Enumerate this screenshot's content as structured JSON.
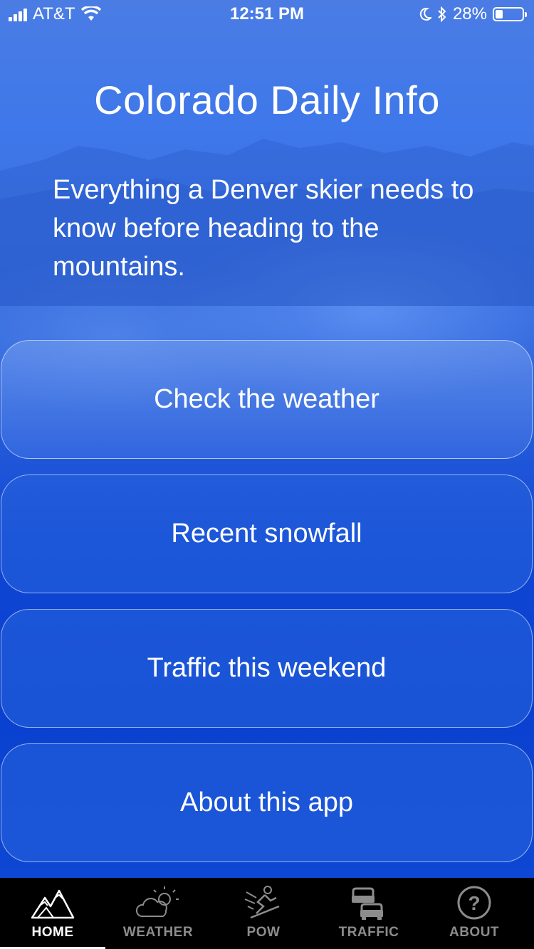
{
  "status_bar": {
    "carrier": "AT&T",
    "time": "12:51 PM",
    "battery_percent": "28%",
    "battery_level": 0.28
  },
  "header": {
    "title": "Colorado Daily Info",
    "subtitle": "Everything a Denver skier needs to know before heading to the mountains."
  },
  "menu": [
    {
      "label": "Check the weather"
    },
    {
      "label": "Recent snowfall"
    },
    {
      "label": "Traffic this weekend"
    },
    {
      "label": "About this app"
    }
  ],
  "tabbar": {
    "active": "HOME",
    "tabs": [
      {
        "label": "HOME",
        "icon": "mountains-icon"
      },
      {
        "label": "WEATHER",
        "icon": "partly-cloudy-icon"
      },
      {
        "label": "POW",
        "icon": "skier-icon"
      },
      {
        "label": "TRAFFIC",
        "icon": "cars-icon"
      },
      {
        "label": "ABOUT",
        "icon": "question-icon"
      }
    ]
  },
  "colors": {
    "background_top": "#4a7ce4",
    "background_bottom": "#0a40cf",
    "tabbar": "#000000",
    "tab_active": "#ffffff",
    "tab_inactive": "#8c8c8c"
  }
}
